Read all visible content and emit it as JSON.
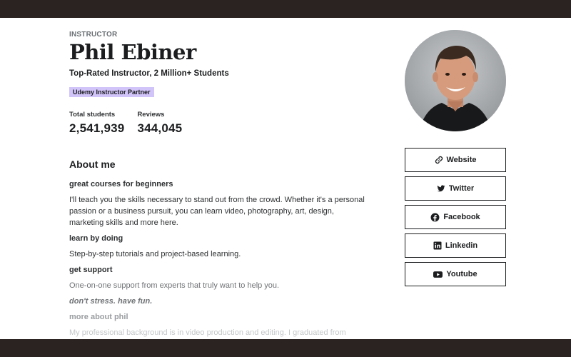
{
  "profile": {
    "role_label": "INSTRUCTOR",
    "name": "Phil Ebiner",
    "headline": "Top-Rated Instructor, 2 Million+ Students",
    "badge": "Udemy Instructor Partner"
  },
  "stats": {
    "students_label": "Total students",
    "students_value": "2,541,939",
    "reviews_label": "Reviews",
    "reviews_value": "344,045"
  },
  "about": {
    "title": "About me",
    "sections": [
      {
        "heading": "great courses for beginners",
        "text": "I'll teach you the skills necessary to stand out from the crowd. Whether it's a personal passion or a business pursuit, you can learn video, photography, art, design, marketing skills and more here."
      },
      {
        "heading": "learn by doing",
        "text": "Step-by-step tutorials and project-based learning."
      },
      {
        "heading": "get support",
        "text": "One-on-one support from experts that truly want to help you."
      },
      {
        "heading": "don't stress. have fun.",
        "text": ""
      },
      {
        "heading": "more about phil",
        "text": "My professional background is in video production and editing. I graduated from"
      }
    ]
  },
  "links": [
    {
      "label": "Website",
      "icon": "link-icon"
    },
    {
      "label": "Twitter",
      "icon": "twitter-icon"
    },
    {
      "label": "Facebook",
      "icon": "facebook-icon"
    },
    {
      "label": "Linkedin",
      "icon": "linkedin-icon"
    },
    {
      "label": "Youtube",
      "icon": "youtube-icon"
    }
  ],
  "colors": {
    "frame_bar": "#2b2322",
    "badge_bg": "#d1c4f8",
    "text_primary": "#1c1d1f"
  }
}
